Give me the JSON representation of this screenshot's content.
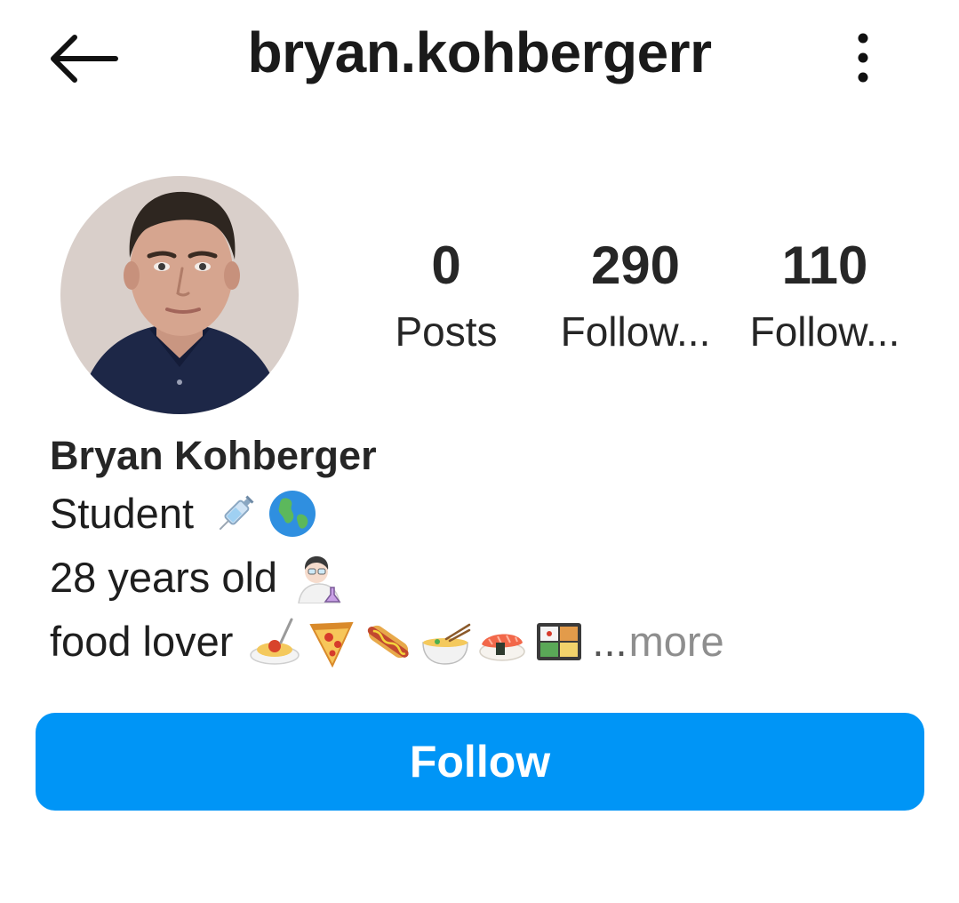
{
  "header": {
    "username": "bryan.kohbergerr",
    "back_icon": "arrow-left-icon",
    "more_icon": "vertical-dots-icon"
  },
  "stats": {
    "posts": {
      "value": "0",
      "label": "Posts"
    },
    "followers": {
      "value": "290",
      "label": "Follow..."
    },
    "following": {
      "value": "110",
      "label": "Follow..."
    }
  },
  "profile": {
    "full_name": "Bryan Kohberger",
    "bio_lines": [
      {
        "text": "Student",
        "emojis": [
          "syringe-emoji",
          "globe-emoji"
        ]
      },
      {
        "text": "28 years old",
        "emojis": [
          "scientist-emoji"
        ]
      },
      {
        "text": "food lover",
        "emojis": [
          "spaghetti-emoji",
          "pizza-emoji",
          "hotdog-emoji",
          "ramen-emoji",
          "sushi-emoji",
          "bento-emoji"
        ]
      }
    ],
    "ellipsis": "...",
    "more_label": "more"
  },
  "actions": {
    "follow_label": "Follow"
  },
  "colors": {
    "follow_button": "#0095f6",
    "text_primary": "#262626",
    "more_link": "#8e8e8e"
  }
}
